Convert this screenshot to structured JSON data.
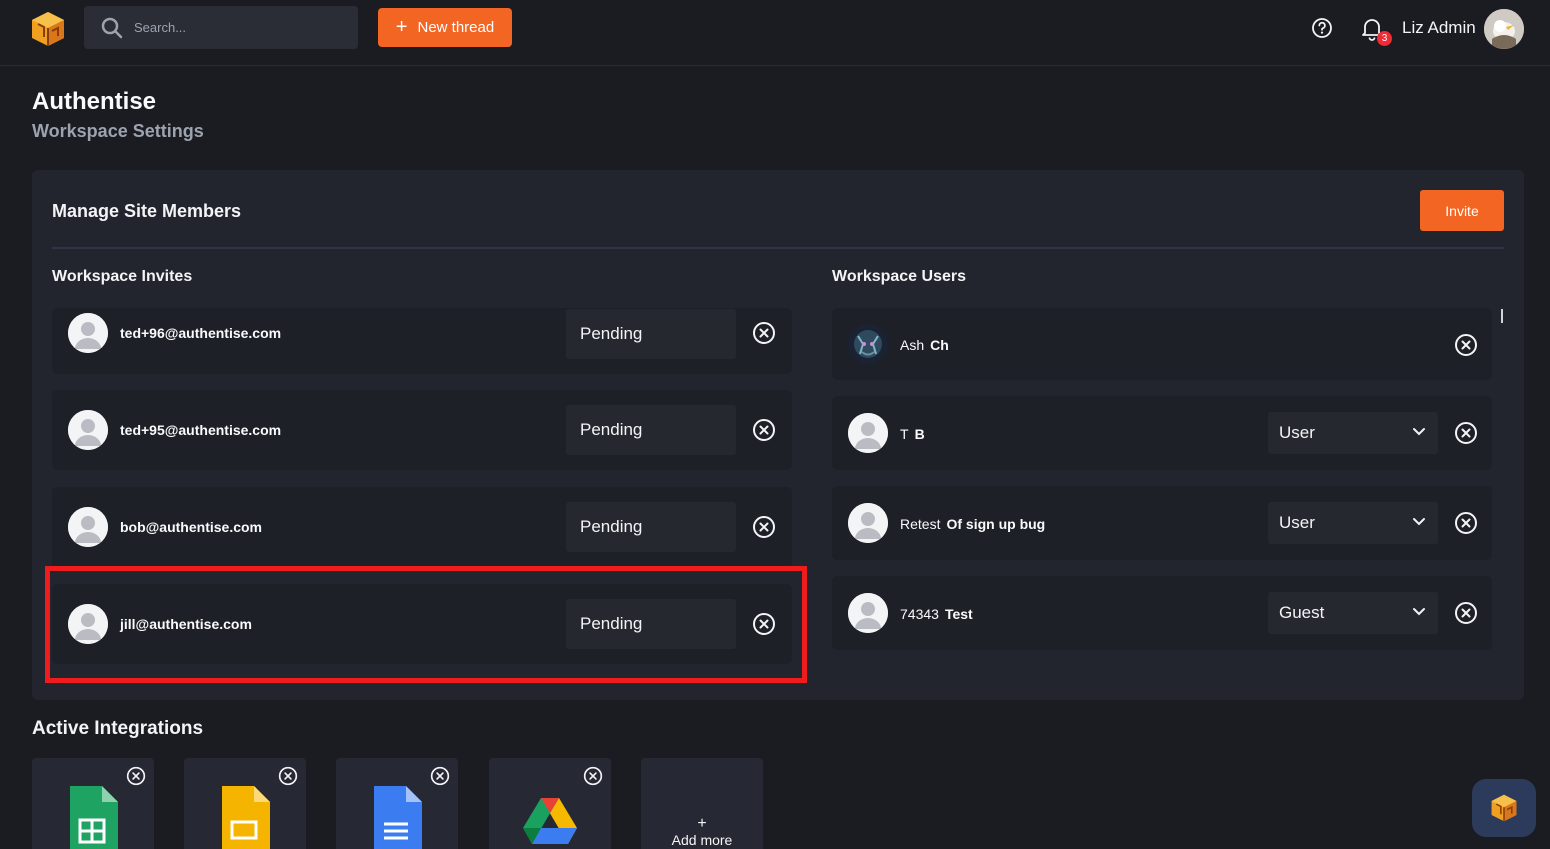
{
  "topbar": {
    "search_placeholder": "Search...",
    "new_thread_label": "New thread",
    "notification_count": "3",
    "user_name": "Liz Admin"
  },
  "header": {
    "title": "Authentise",
    "subtitle": "Workspace Settings"
  },
  "members": {
    "title": "Manage Site Members",
    "invite_label": "Invite",
    "invites_heading": "Workspace Invites",
    "users_heading": "Workspace Users",
    "invites": [
      {
        "email": "ted+96@authentise.com",
        "status": "Pending"
      },
      {
        "email": "ted+95@authentise.com",
        "status": "Pending"
      },
      {
        "email": "bob@authentise.com",
        "status": "Pending"
      },
      {
        "email": "jill@authentise.com",
        "status": "Pending"
      }
    ],
    "users": [
      {
        "first": "Ash",
        "last": "Ch",
        "role": ""
      },
      {
        "first": "T",
        "last": "B",
        "role": "User"
      },
      {
        "first": "Retest",
        "last": "Of sign up bug",
        "role": "User"
      },
      {
        "first": "74343",
        "last": "Test",
        "role": "Guest"
      }
    ]
  },
  "integrations": {
    "title": "Active Integrations",
    "items": [
      {
        "name": "google-sheets-icon"
      },
      {
        "name": "google-slides-icon"
      },
      {
        "name": "google-docs-icon"
      },
      {
        "name": "google-drive-icon"
      }
    ],
    "add_more_plus": "+",
    "add_more_label": "Add more"
  },
  "colors": {
    "accent": "#f26522",
    "background": "#1b1c22",
    "panel": "#23252e",
    "highlight": "#ee1c1c"
  }
}
